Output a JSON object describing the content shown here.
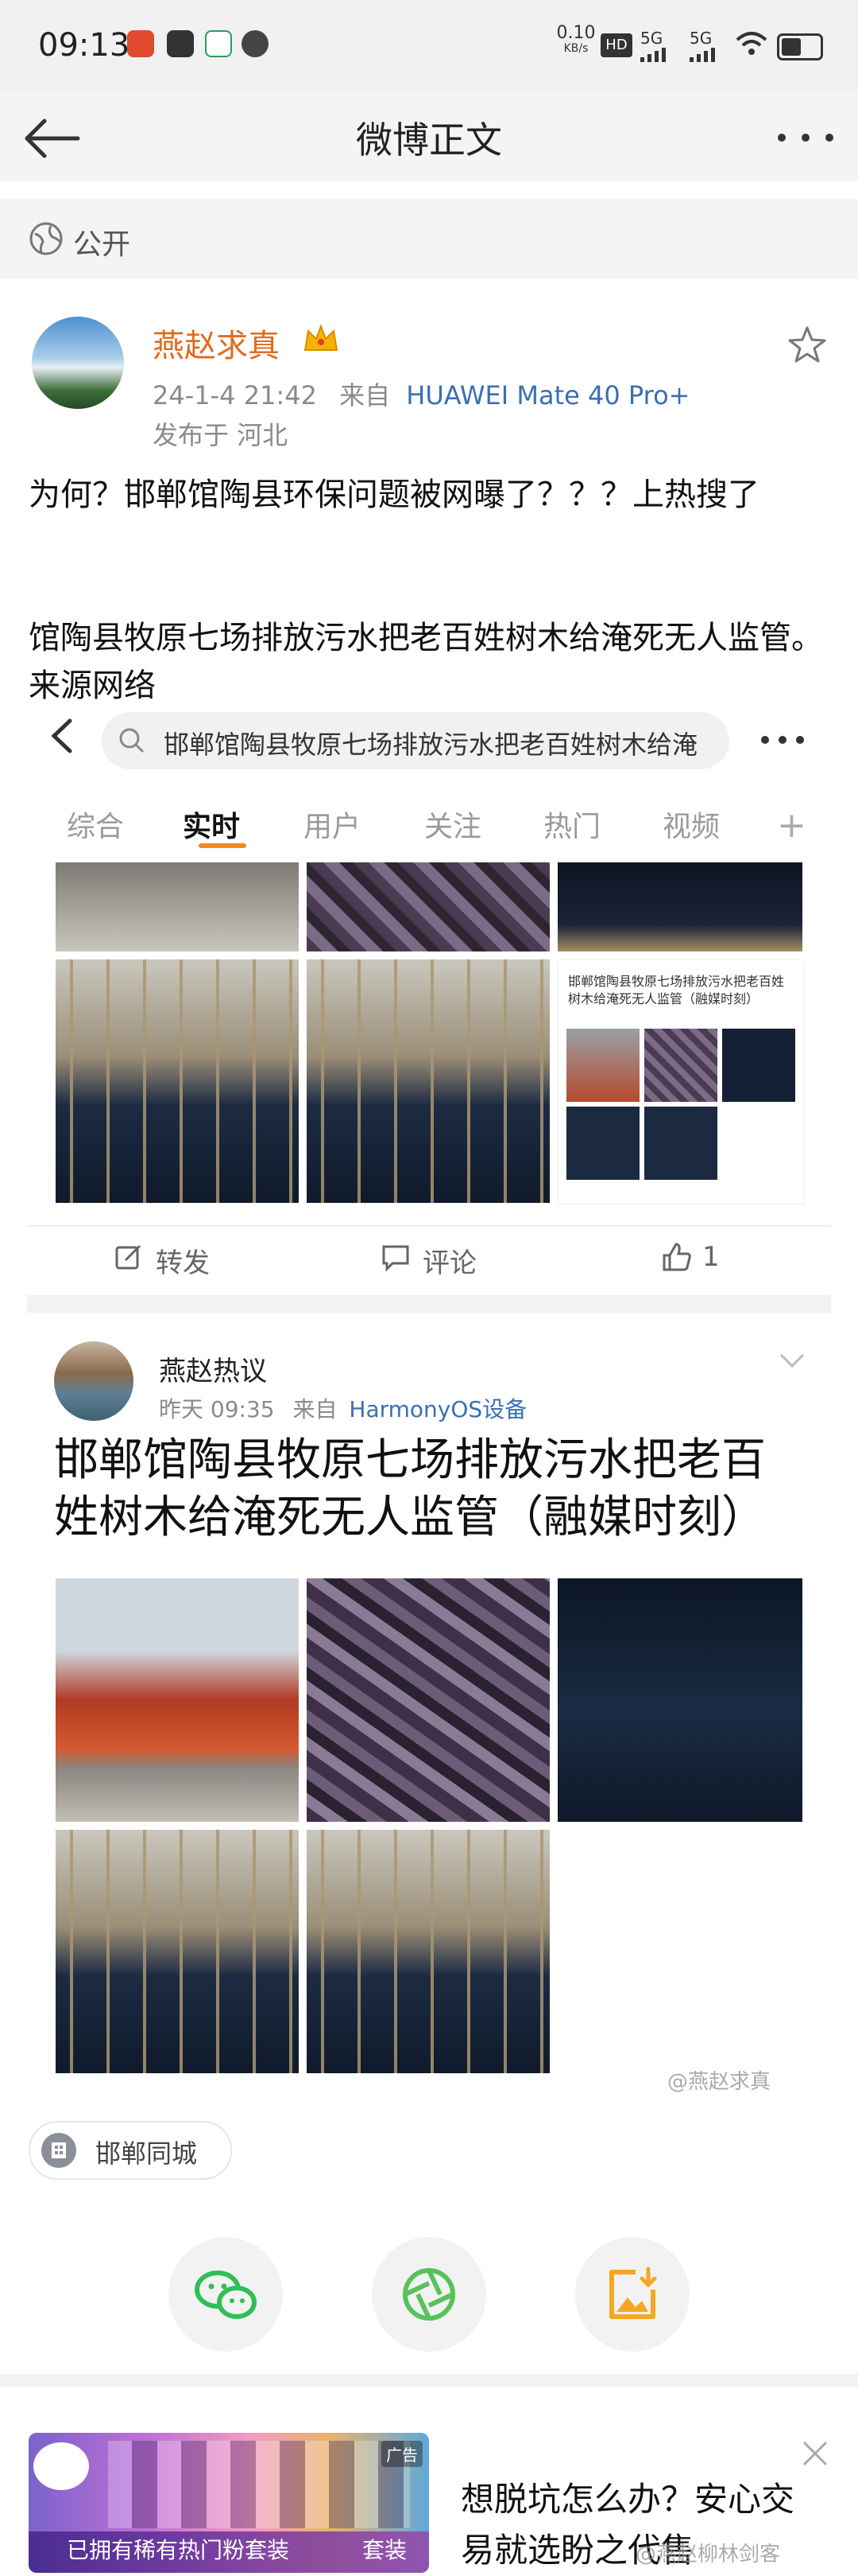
{
  "status_bar": {
    "time": "09:13",
    "speed": "0.10",
    "speed_unit": "KB/s",
    "hd": "HD",
    "net1": "5G",
    "net2": "5G"
  },
  "nav": {
    "title": "微博正文"
  },
  "visibility": {
    "label": "公开"
  },
  "post": {
    "author": "燕赵求真",
    "time": "24-1-4 21:42",
    "from_label": "来自",
    "device": "HUAWEI Mate 40 Pro+",
    "location": "发布于 河北",
    "text_line1": "为何？邯郸馆陶县环保问题被网曝了？？？上热搜了",
    "text_line2": "馆陶县牧原七场排放污水把老百姓树木给淹死无人监管。来源网络"
  },
  "embedded": {
    "search_text": "邯郸馆陶县牧原七场排放污水把老百姓树木给淹",
    "tabs": [
      "综合",
      "实时",
      "用户",
      "关注",
      "热门",
      "视频"
    ],
    "active_tab": "实时",
    "preview_caption": "邯郸馆陶县牧原七场排放污水把老百姓树木给淹死无人监管（融媒时刻）",
    "actions": {
      "repost": "转发",
      "comment": "评论",
      "like": "1"
    },
    "card": {
      "author": "燕赵热议",
      "time": "昨天 09:35",
      "from_label": "来自",
      "device": "HarmonyOS设备",
      "title": "邯郸馆陶县牧原七场排放污水把老百姓树木给淹死无人监管（融媒时刻）",
      "watermark": "@燕赵求真"
    }
  },
  "topic_tag": {
    "label": "邯郸同城"
  },
  "ad": {
    "text": "想脱坑怎么办？安心交易就选盼之代售",
    "banner_text": "已拥有稀有热门粉套装",
    "banner_suffix": "套装",
    "corner": "广告",
    "watermark": "@燕赵柳林剑客"
  },
  "colors": {
    "accent_orange": "#e06b1c",
    "link_blue": "#3a6fb3",
    "wechat_green": "#2fbf57",
    "moments_green": "#58c25a",
    "save_orange": "#f5a623"
  }
}
